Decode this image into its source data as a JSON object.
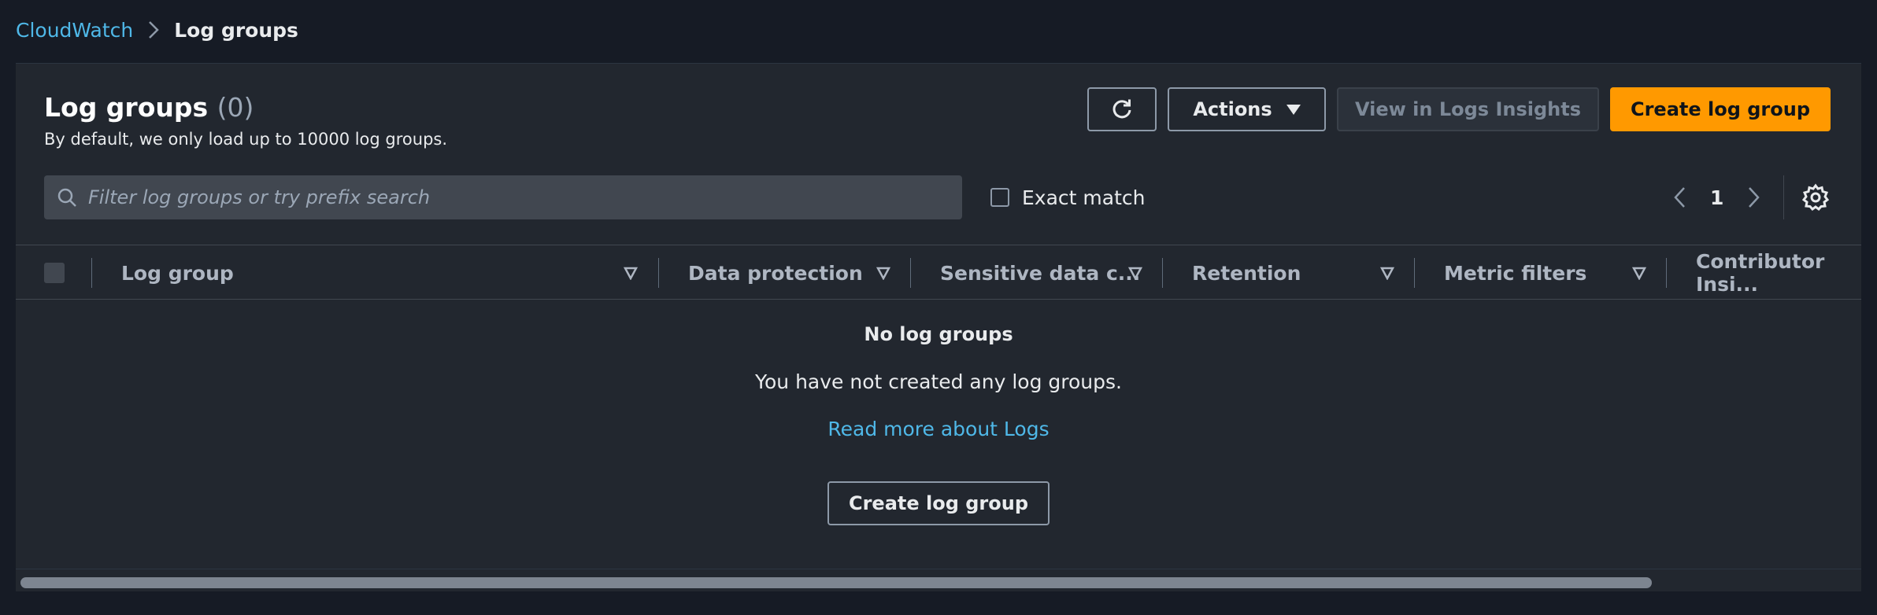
{
  "breadcrumb": {
    "parent": "CloudWatch",
    "current": "Log groups"
  },
  "header": {
    "title": "Log groups",
    "count": "(0)",
    "description": "By default, we only load up to 10000 log groups."
  },
  "toolbar": {
    "actions_label": "Actions",
    "insights_label": "View in Logs Insights",
    "create_label": "Create log group"
  },
  "search": {
    "placeholder": "Filter log groups or try prefix search"
  },
  "filter": {
    "exact_match_label": "Exact match"
  },
  "pagination": {
    "current_page": "1"
  },
  "table": {
    "columns": [
      "Log group",
      "Data protection",
      "Sensitive data c...",
      "Retention",
      "Metric filters",
      "Contributor Insi..."
    ]
  },
  "empty_state": {
    "title": "No log groups",
    "description": "You have not created any log groups.",
    "link": "Read more about Logs",
    "button": "Create log group"
  },
  "colors": {
    "background": "#161b25",
    "panel": "#22272f",
    "accent_primary": "#ff9900",
    "link": "#4fb8e8"
  }
}
